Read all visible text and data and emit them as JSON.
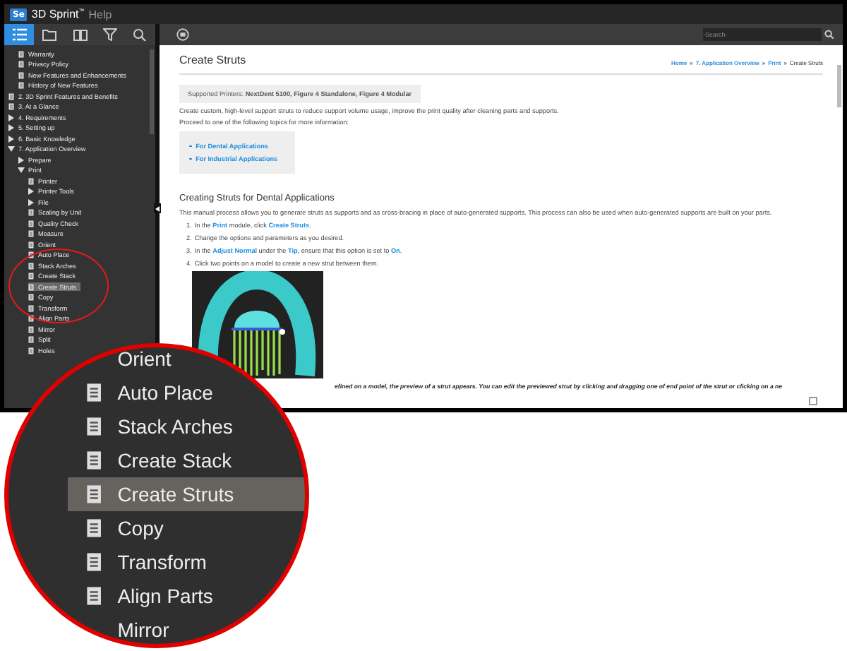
{
  "app": {
    "logo": "Se",
    "title": "3D Sprint$^{™}$",
    "subtitle": "Help"
  },
  "sidebar": {
    "tabs": [
      {
        "selected": true
      },
      {
        "selected": false
      },
      {
        "selected": false
      },
      {
        "selected": false
      },
      {
        "selected": false
      }
    ],
    "tree": [
      {
        "children": [
          {
            "label": "Warranty",
            "kind": "page",
            "selected": false
          },
          {
            "label": "Privacy Policy",
            "kind": "page",
            "selected": false
          },
          {
            "label": "New Features and Enhancements",
            "kind": "page",
            "selected": false
          },
          {
            "label": "History of New Features",
            "kind": "page",
            "selected": false
          }
        ]
      },
      {
        "label": "2. 3D Sprint Features and Benefits",
        "kind": "page",
        "selected": false
      },
      {
        "label": "3. At a Glance",
        "kind": "page",
        "selected": false
      },
      {
        "label": "4. Requirements",
        "kind": "book",
        "expanded": false,
        "selected": false
      },
      {
        "label": "5. Setting up",
        "kind": "book",
        "expanded": false,
        "selected": false
      },
      {
        "label": "6. Basic Knowledge",
        "kind": "book",
        "expanded": false,
        "selected": false
      },
      {
        "label": "7. Application Overview",
        "kind": "book",
        "expanded": true,
        "selected": false,
        "children": [
          {
            "label": "Prepare",
            "kind": "book",
            "expanded": false,
            "selected": false
          },
          {
            "label": "Print",
            "kind": "book",
            "expanded": true,
            "selected": false,
            "children": [
              {
                "label": "Printer",
                "kind": "page",
                "selected": false
              },
              {
                "label": "Printer Tools",
                "kind": "book",
                "expanded": false,
                "selected": false
              },
              {
                "label": "File",
                "kind": "book",
                "expanded": false,
                "selected": false
              },
              {
                "label": "Scaling by Unit",
                "kind": "page",
                "selected": false
              },
              {
                "label": "Quality Check",
                "kind": "page",
                "selected": false
              },
              {
                "label": "Measure",
                "kind": "page",
                "selected": false
              },
              {
                "label": "Orient",
                "kind": "page",
                "selected": false
              },
              {
                "label": "Auto Place",
                "kind": "page",
                "selected": false
              },
              {
                "label": "Stack Arches",
                "kind": "page",
                "selected": false
              },
              {
                "label": "Create Stack",
                "kind": "page",
                "selected": false
              },
              {
                "label": "Create Struts",
                "kind": "page",
                "selected": true
              },
              {
                "label": "Copy",
                "kind": "page",
                "selected": false
              },
              {
                "label": "Transform",
                "kind": "page",
                "selected": false
              },
              {
                "label": "Align Parts",
                "kind": "page",
                "selected": false
              },
              {
                "label": "Mirror",
                "kind": "page",
                "selected": false
              },
              {
                "label": "Split",
                "kind": "page",
                "selected": false
              },
              {
                "label": "Holes",
                "kind": "page",
                "selected": false
              }
            ]
          }
        ]
      }
    ]
  },
  "search": {
    "placeholder": "-Search-"
  },
  "content": {
    "title": "Create Struts",
    "breadcrumb": [
      {
        "label": "Home",
        "link": true
      },
      {
        "label": "»",
        "link": false
      },
      {
        "label": "7. Application Overview",
        "link": true
      },
      {
        "label": "»",
        "link": false
      },
      {
        "label": "Print",
        "link": true
      },
      {
        "label": "»",
        "link": false
      },
      {
        "label": "Create Struts",
        "link": false
      }
    ],
    "supported": "Supported Printers: **NextDent 5100, Figure 4 Standalone, Figure 4 Modular**",
    "intro": [
      "Create custom, high-level support struts to reduce support volume usage, improve the print quality after cleaning parts and supports.",
      "Proceed to one of the following topics for more information:"
    ],
    "topics": [
      "For Dental Applications",
      "For Industrial Applications"
    ],
    "heading": "Creating Struts for Dental Applications",
    "description": "This manual process allows you to generate struts as supports and as cross-bracing in place of auto-generated supports. This process can also be used when auto-generated supports are built on your parts.",
    "steps": [
      {
        "number": "1.",
        "parts": [
          {
            "text": "In the ",
            "link": false
          },
          {
            "text": "Print",
            "link": true
          },
          {
            "text": " module, click ",
            "link": false
          },
          {
            "text": "Create Struts",
            "link": true
          },
          {
            "text": ".",
            "link": false
          }
        ]
      },
      {
        "number": "2.",
        "parts": [
          {
            "text": "Change the options and parameters as you desired.",
            "link": false
          }
        ]
      },
      {
        "number": "3.",
        "parts": [
          {
            "text": "In the ",
            "link": false
          },
          {
            "text": "Adjust Normal",
            "link": true
          },
          {
            "text": " under the ",
            "link": false
          },
          {
            "text": "Tip",
            "link": true
          },
          {
            "text": ", ensure that this option is set to ",
            "link": false
          },
          {
            "text": "On",
            "link": true
          },
          {
            "text": ".",
            "link": false
          }
        ]
      },
      {
        "number": "4.",
        "parts": [
          {
            "text": "Click two points on a model to create a new strut between them.",
            "link": false
          }
        ]
      }
    ],
    "note": "efined on a model, the preview of a strut appears. You can edit the previewed strut by clicking and dragging one of end point of the strut or clicking on a ne"
  },
  "magnifier": {
    "items": [
      {
        "label": "Orient",
        "kind": "text",
        "selected": false
      },
      {
        "label": "Auto Place",
        "kind": "page",
        "selected": false
      },
      {
        "label": "Stack Arches",
        "kind": "page",
        "selected": false
      },
      {
        "label": "Create Stack",
        "kind": "page",
        "selected": false
      },
      {
        "label": "Create Struts",
        "kind": "page",
        "selected": true
      },
      {
        "label": "Copy",
        "kind": "page",
        "selected": false
      },
      {
        "label": "Transform",
        "kind": "page",
        "selected": false
      },
      {
        "label": "Align Parts",
        "kind": "page",
        "selected": false
      },
      {
        "label": "Mirror",
        "kind": "text",
        "selected": false
      }
    ]
  }
}
